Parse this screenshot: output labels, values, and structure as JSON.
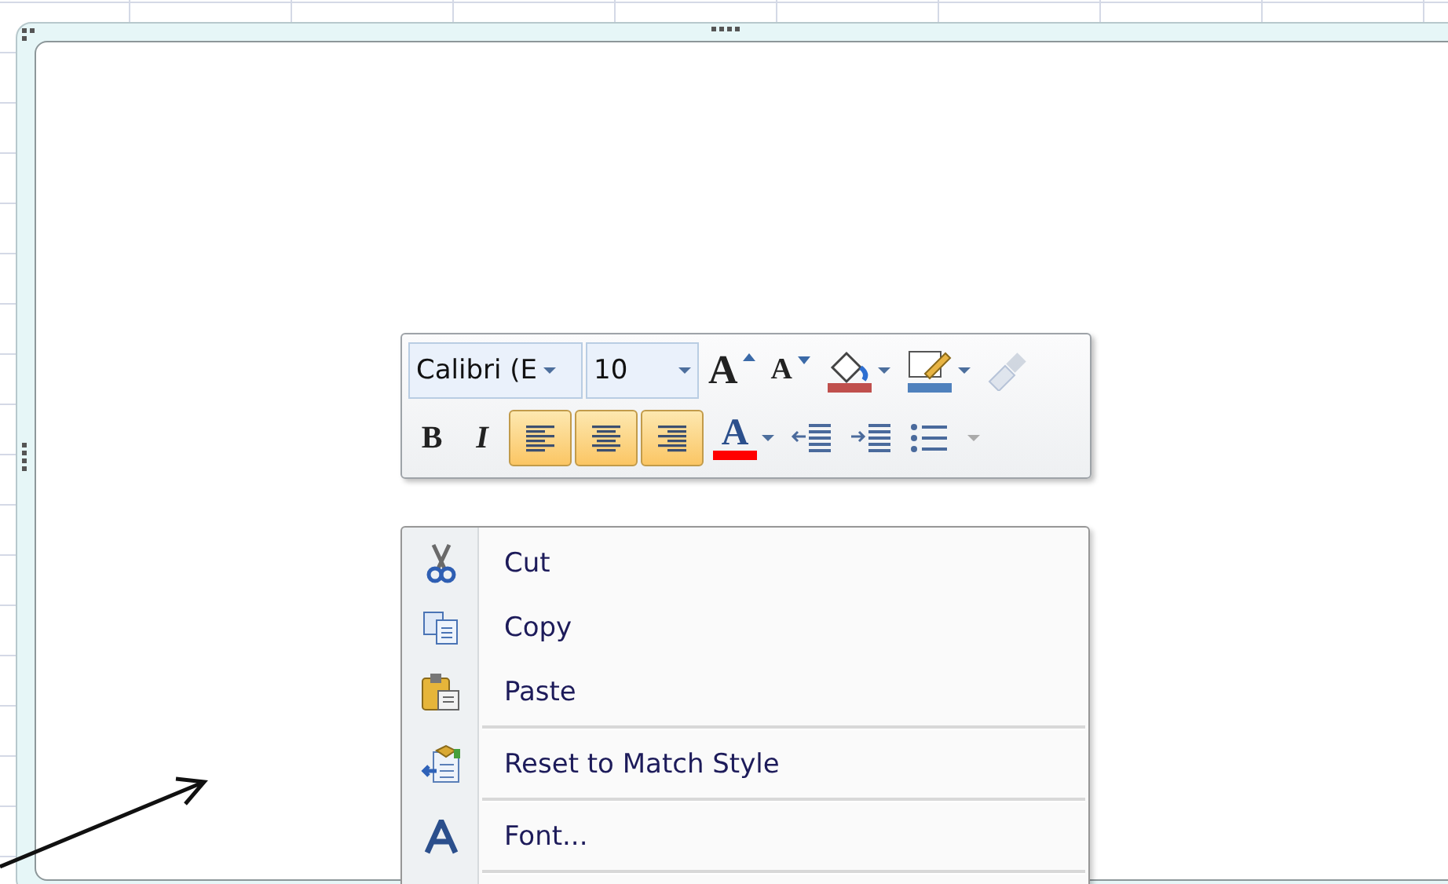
{
  "toolbar": {
    "font_name": "Calibri (E",
    "font_size": "10",
    "row1": [
      {
        "kind": "grow-font",
        "glyph": "A"
      },
      {
        "kind": "shrink-font",
        "glyph": "A"
      },
      {
        "kind": "fill-color",
        "color": "#c0504d"
      },
      {
        "kind": "line-color",
        "color": "#4f81bd"
      },
      {
        "kind": "format-painter",
        "disabled": true
      }
    ],
    "row2": [
      {
        "kind": "bold",
        "glyph": "B"
      },
      {
        "kind": "italic",
        "glyph": "I"
      },
      {
        "kind": "align-left",
        "selected": true
      },
      {
        "kind": "align-center",
        "selected": true
      },
      {
        "kind": "align-right",
        "selected": true
      },
      {
        "kind": "font-color",
        "glyph": "A",
        "color": "#ff0000"
      },
      {
        "kind": "decrease-indent"
      },
      {
        "kind": "increase-indent"
      },
      {
        "kind": "bullets"
      }
    ]
  },
  "menu": [
    {
      "kind": "cut",
      "label": "Cut"
    },
    {
      "kind": "copy",
      "label": "Copy"
    },
    {
      "kind": "paste",
      "label": "Paste"
    },
    {
      "kind": "separator"
    },
    {
      "kind": "reset",
      "label": "Reset to Match Style"
    },
    {
      "kind": "separator"
    },
    {
      "kind": "font",
      "label": "Font..."
    },
    {
      "kind": "separator"
    }
  ]
}
